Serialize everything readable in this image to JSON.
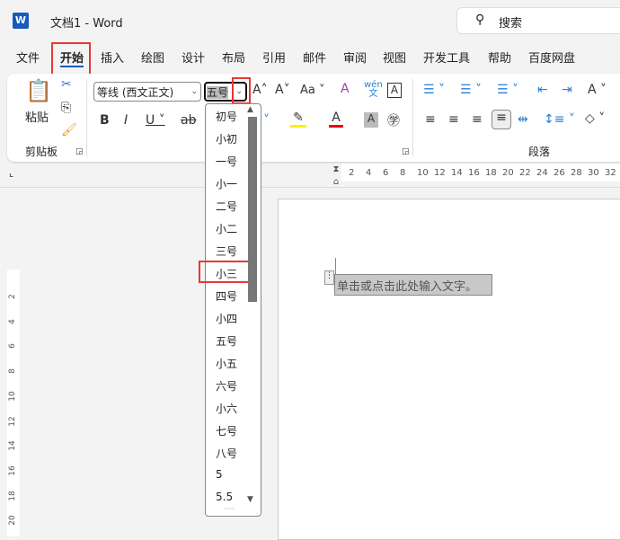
{
  "title": "文档1  -  Word",
  "search": {
    "placeholder": "搜索"
  },
  "tabs": [
    "文件",
    "开始",
    "插入",
    "绘图",
    "设计",
    "布局",
    "引用",
    "邮件",
    "审阅",
    "视图",
    "开发工具",
    "帮助",
    "百度网盘"
  ],
  "clipboard": {
    "paste": "粘贴",
    "group": "剪贴板"
  },
  "font": {
    "name": "等线 (西文正文)",
    "size": "五号"
  },
  "paragraph": {
    "group": "段落"
  },
  "size_options": [
    "初号",
    "小初",
    "一号",
    "小一",
    "二号",
    "小二",
    "三号",
    "小三",
    "四号",
    "小四",
    "五号",
    "小五",
    "六号",
    "小六",
    "七号",
    "八号",
    "5",
    "5.5"
  ],
  "highlighted_option": "小三",
  "ruler_top": [
    "2",
    "4",
    "6",
    "8",
    "10",
    "12",
    "14",
    "16",
    "18",
    "20",
    "22",
    "24",
    "26",
    "28",
    "30",
    "32"
  ],
  "ruler_left": [
    "2",
    "4",
    "6",
    "8",
    "10",
    "12",
    "14",
    "16",
    "18",
    "20"
  ],
  "document": {
    "placeholder_text": "单击或点击此处输入文字。"
  },
  "colors": {
    "accent": "#185abd",
    "highlight_box": "#e53935"
  }
}
